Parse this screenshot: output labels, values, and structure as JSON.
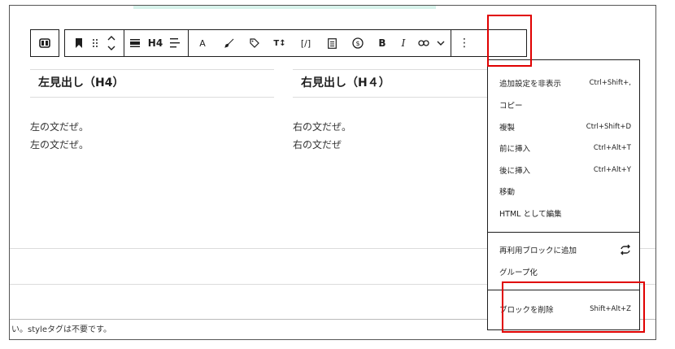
{
  "toolbar": {
    "heading_level": "H4",
    "text_a": "A",
    "bold": "B",
    "italic": "I",
    "code": "[/]",
    "font_size": "T↕",
    "more": "⋮"
  },
  "columns": [
    {
      "heading": "左見出し（H4）",
      "lines": [
        "左の文だぜ。",
        "左の文だぜ。"
      ]
    },
    {
      "heading": "右見出し（H４）",
      "lines": [
        "右の文だぜ。",
        "右の文だぜ"
      ]
    }
  ],
  "footer_text": "い。styleタグは不要です。",
  "menu": {
    "section1": [
      {
        "label": "追加設定を非表示",
        "shortcut": "Ctrl+Shift+,"
      },
      {
        "label": "コピー",
        "shortcut": ""
      },
      {
        "label": "複製",
        "shortcut": "Ctrl+Shift+D"
      },
      {
        "label": "前に挿入",
        "shortcut": "Ctrl+Alt+T"
      },
      {
        "label": "後に挿入",
        "shortcut": "Ctrl+Alt+Y"
      },
      {
        "label": "移動",
        "shortcut": ""
      },
      {
        "label": "HTML として編集",
        "shortcut": ""
      }
    ],
    "section2": [
      {
        "label": "再利用ブロックに追加",
        "icon": "reusable-block-icon"
      },
      {
        "label": "グループ化"
      }
    ],
    "section3": [
      {
        "label": "ブロックを削除",
        "shortcut": "Shift+Alt+Z"
      }
    ]
  },
  "colors": {
    "highlight": "#e00000",
    "accent_strip": "#d6f2ea"
  }
}
